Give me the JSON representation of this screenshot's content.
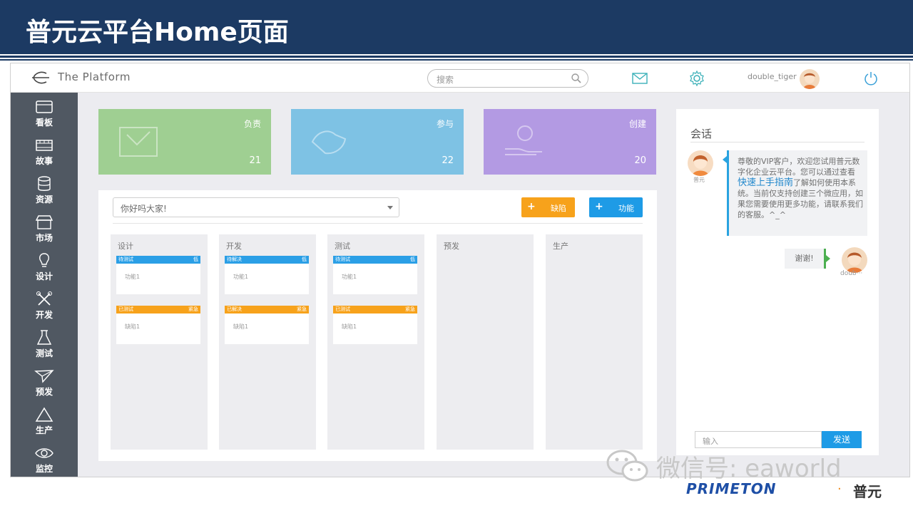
{
  "slide": {
    "title": "普元云平台Home页面"
  },
  "app": {
    "brand": "The Platform",
    "search_placeholder": "搜索",
    "username": "double_tiger"
  },
  "sidebar": {
    "items": [
      {
        "label": "看板",
        "icon": "board-icon"
      },
      {
        "label": "故事",
        "icon": "film-icon"
      },
      {
        "label": "资源",
        "icon": "database-icon"
      },
      {
        "label": "市场",
        "icon": "store-icon"
      },
      {
        "label": "设计",
        "icon": "lightbulb-icon"
      },
      {
        "label": "开发",
        "icon": "tools-icon"
      },
      {
        "label": "测试",
        "icon": "flask-icon"
      },
      {
        "label": "预发",
        "icon": "paper-plane-icon"
      },
      {
        "label": "生产",
        "icon": "triangle-icon"
      },
      {
        "label": "监控",
        "icon": "eye-icon"
      }
    ]
  },
  "tiles": [
    {
      "label": "负责",
      "count": "21",
      "color": "#9fcf92"
    },
    {
      "label": "参与",
      "count": "22",
      "color": "#7ec2e4"
    },
    {
      "label": "创建",
      "count": "20",
      "color": "#b39ae3"
    }
  ],
  "board": {
    "select_value": "你好吗大家!",
    "defect_button": "缺陷",
    "feature_button": "功能",
    "columns": [
      {
        "title": "设计",
        "cards": [
          {
            "status": "待测试",
            "priority": "低",
            "title": "功能1",
            "color": "#2b9fe6"
          },
          {
            "status": "已测试",
            "priority": "紧急",
            "title": "缺陷1",
            "color": "#f7a21b"
          }
        ]
      },
      {
        "title": "开发",
        "cards": [
          {
            "status": "待解决",
            "priority": "低",
            "title": "功能1",
            "color": "#2b9fe6"
          },
          {
            "status": "已解决",
            "priority": "紧急",
            "title": "缺陷1",
            "color": "#f7a21b"
          }
        ]
      },
      {
        "title": "测试",
        "cards": [
          {
            "status": "待测试",
            "priority": "低",
            "title": "功能1",
            "color": "#2b9fe6"
          },
          {
            "status": "已测试",
            "priority": "紧急",
            "title": "缺陷1",
            "color": "#f7a21b"
          }
        ]
      },
      {
        "title": "预发",
        "cards": []
      },
      {
        "title": "生产",
        "cards": []
      }
    ]
  },
  "chat": {
    "title": "会话",
    "bot_name": "普元",
    "bot_message_part1": "尊敬的VIP客户，欢迎您试用普元数字化企业云平台。您可以通过查看",
    "bot_message_link": "快速上手指南",
    "bot_message_part2": "了解如何使用本系统。当前仅支持创建三个微应用，如果您需要使用更多功能，请联系我们的客服。^_^",
    "user_message": "谢谢!",
    "user_name": "doub···",
    "input_placeholder": "输入",
    "send_label": "发送"
  },
  "watermark": {
    "text": "微信号: eaworld",
    "logo": "PRIMETON",
    "logo_cn": "普元"
  }
}
